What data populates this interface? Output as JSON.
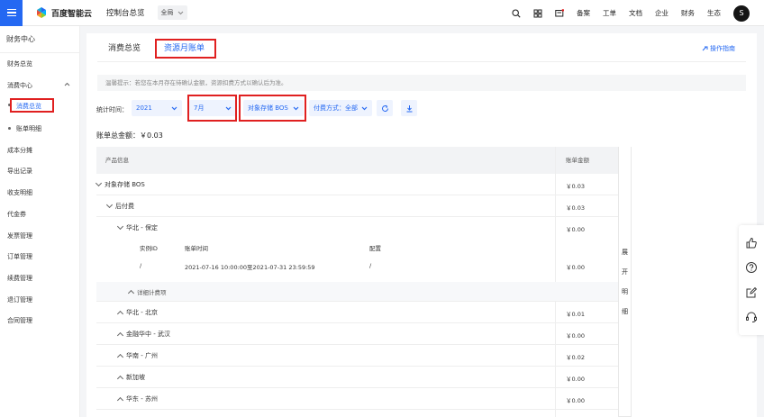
{
  "topbar": {
    "logo_text": "百度智能云",
    "console_title": "控制台总览",
    "region": "全局",
    "nav": [
      "备案",
      "工单",
      "文档",
      "企业",
      "财务",
      "生态"
    ],
    "avatar_letter": "S"
  },
  "sidebar": {
    "title": "财务中心",
    "items": [
      "财务总览",
      "消费中心",
      "消费总览",
      "账单明细",
      "成本分摊",
      "导出记录",
      "收支明细",
      "代金券",
      "发票管理",
      "订单管理",
      "续费管理",
      "退订管理",
      "合同管理"
    ]
  },
  "tabs": [
    "消费总览",
    "资源月账单"
  ],
  "guide_link": "操作指南",
  "tip": "温馨提示：若您在本月存在待确认金额，资源扣费方式以确认后为准。",
  "filters": {
    "label": "统计时间：",
    "year": "2021",
    "month": "7月",
    "product": "对象存储 BOS",
    "pay_method": "付费方式：全部"
  },
  "total": "账单总金额：￥0.03",
  "table": {
    "headers": [
      "产品信息",
      "账单金额"
    ],
    "rows": [
      {
        "name": "对象存储 BOS",
        "amount": "￥0.03"
      },
      {
        "name": "后付费",
        "amount": "￥0.03"
      },
      {
        "name": "华北 - 保定",
        "amount": "￥0.00"
      }
    ],
    "detail_headers": [
      "实例ID",
      "账单时间",
      "配置"
    ],
    "detail": {
      "id": "/",
      "time": "2021-07-16 10:00:00至2021-07-31 23:59:59",
      "config": "/",
      "amount": "￥0.00"
    },
    "detail_toggle": "详细计费项",
    "regions": [
      {
        "name": "华北 - 北京",
        "amount": "￥0.01"
      },
      {
        "name": "金融华中 - 武汉",
        "amount": "￥0.00"
      },
      {
        "name": "华南 - 广州",
        "amount": "￥0.02"
      },
      {
        "name": "新加坡",
        "amount": "￥0.00"
      },
      {
        "name": "华东 - 苏州",
        "amount": "￥0.00"
      }
    ],
    "expand_label": [
      "展",
      "开",
      "明",
      "细"
    ]
  }
}
